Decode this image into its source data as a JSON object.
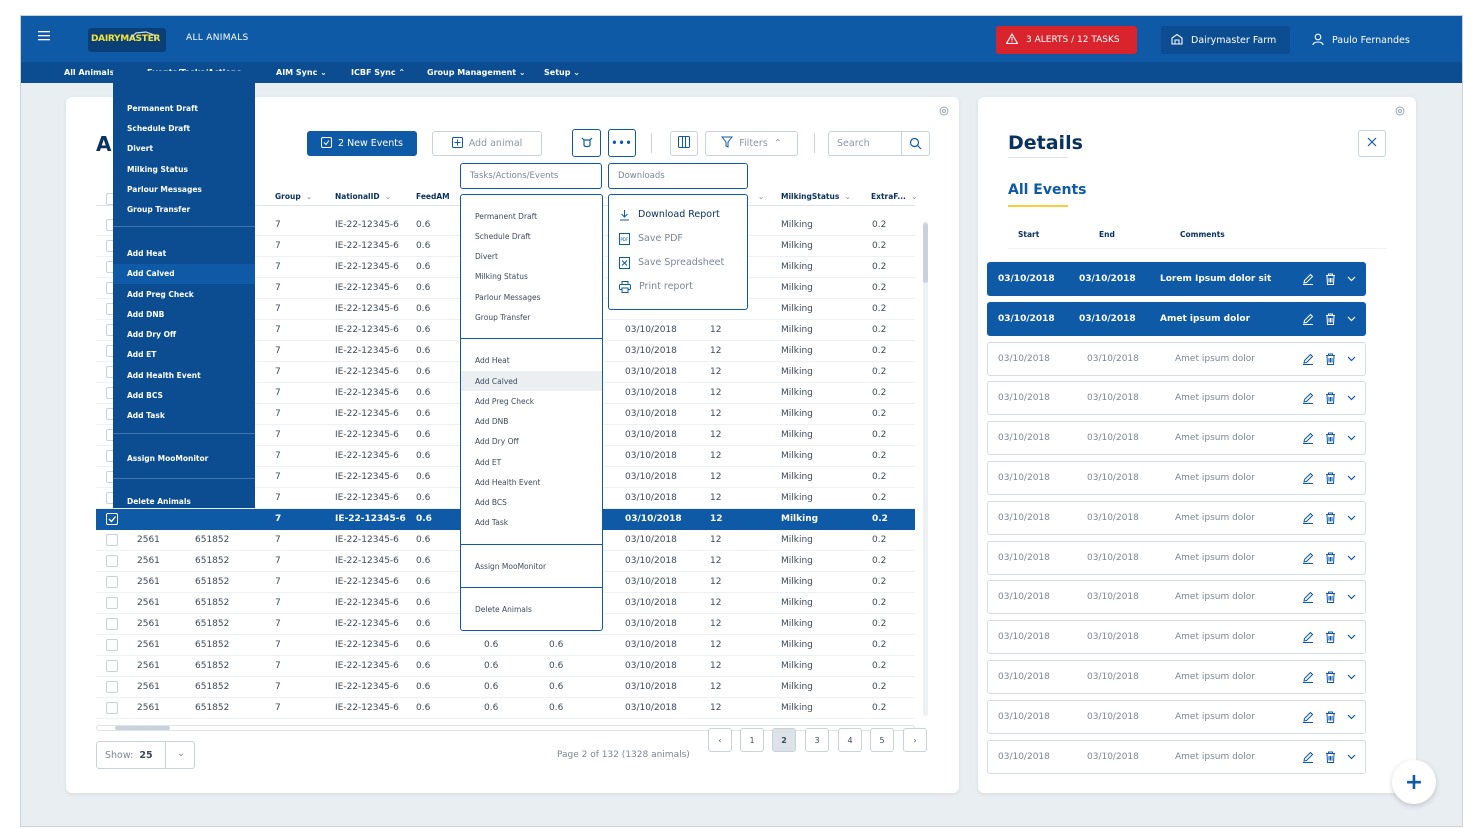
{
  "header": {
    "logo": "DAIRYMASTER",
    "section": "ALL ANIMALS",
    "alerts": "3 ALERTS / 12 TASKS",
    "farm": "Dairymaster Farm",
    "user": "Paulo Fernandes"
  },
  "nav": [
    "All Animals",
    "Events/Tasks/Actions",
    "AIM Sync",
    "ICBF Sync",
    "Group Management",
    "Setup"
  ],
  "main": {
    "title": "All",
    "new_events": "2 New Events",
    "add_animal": "Add animal",
    "filters": "Filters",
    "search_placeholder": "Search"
  },
  "columns": [
    "Group",
    "NationalID",
    "FeedAM",
    "MilkingStatus",
    "ExtraF..."
  ],
  "rows": [
    [
      "2561",
      "651852",
      "7",
      "IE-22-12345-6",
      "0.6",
      "0.6",
      "0.6",
      "03/10/2018",
      "12",
      "Milking",
      "0.2"
    ]
  ],
  "row_values": {
    "tag": "2561",
    "id": "651852",
    "group": "7",
    "national": "IE-22-12345-6",
    "feed": "0.6",
    "f2": "0.6",
    "f3": "0.6",
    "date": "03/10/2018",
    "num": "12",
    "status": "Milking",
    "extra": "0.2"
  },
  "partial_dates": [
    "03/10/2018"
  ],
  "dark_menu": {
    "group1": [
      "Permanent Draft",
      "Schedule Draft",
      "Divert",
      "Milking Status",
      "Parlour Messages",
      "Group Transfer"
    ],
    "group2": [
      "Add Heat",
      "Add Calved",
      "Add Preg Check",
      "Add DNB",
      "Add Dry Off",
      "Add ET",
      "Add Health Event",
      "Add BCS",
      "Add Task"
    ],
    "assign": "Assign MooMonitor",
    "delete": "Delete Animals"
  },
  "tasks_menu": {
    "label": "Tasks/Actions/Events",
    "group1": [
      "Permanent Draft",
      "Schedule Draft",
      "Divert",
      "Milking Status",
      "Parlour Messages",
      "Group Transfer"
    ],
    "group2": [
      "Add Heat",
      "Add Calved",
      "Add Preg Check",
      "Add DNB",
      "Add Dry Off",
      "Add ET",
      "Add Health Event",
      "Add BCS",
      "Add Task"
    ],
    "assign": "Assign MooMonitor",
    "delete": "Delete Animals"
  },
  "downloads_menu": {
    "label": "Downloads",
    "items": [
      "Download Report",
      "Save PDF",
      "Save Spreadsheet",
      "Print report"
    ]
  },
  "pagination": {
    "show_label": "Show:",
    "show_value": "25",
    "info": "Page 2 of 132 (1328 animals)",
    "pages": [
      "1",
      "2",
      "3",
      "4",
      "5"
    ]
  },
  "details": {
    "title": "Details",
    "section": "All Events",
    "col_start": "Start",
    "col_end": "End",
    "col_comments": "Comments",
    "events": [
      {
        "start": "03/10/2018",
        "end": "03/10/2018",
        "comment": "Lorem Ipsum dolor sit"
      },
      {
        "start": "03/10/2018",
        "end": "03/10/2018",
        "comment": "Amet ipsum dolor"
      },
      {
        "start": "03/10/2018",
        "end": "03/10/2018",
        "comment": "Amet ipsum dolor"
      },
      {
        "start": "03/10/2018",
        "end": "03/10/2018",
        "comment": "Amet ipsum dolor"
      },
      {
        "start": "03/10/2018",
        "end": "03/10/2018",
        "comment": "Amet ipsum dolor"
      },
      {
        "start": "03/10/2018",
        "end": "03/10/2018",
        "comment": "Amet ipsum dolor"
      },
      {
        "start": "03/10/2018",
        "end": "03/10/2018",
        "comment": "Amet ipsum dolor"
      },
      {
        "start": "03/10/2018",
        "end": "03/10/2018",
        "comment": "Amet ipsum dolor"
      },
      {
        "start": "03/10/2018",
        "end": "03/10/2018",
        "comment": "Amet ipsum dolor"
      },
      {
        "start": "03/10/2018",
        "end": "03/10/2018",
        "comment": "Amet ipsum dolor"
      },
      {
        "start": "03/10/2018",
        "end": "03/10/2018",
        "comment": "Amet ipsum dolor"
      },
      {
        "start": "03/10/2018",
        "end": "03/10/2018",
        "comment": "Amet ipsum dolor"
      },
      {
        "start": "03/10/2018",
        "end": "03/10/2018",
        "comment": "Amet ipsum dolor"
      }
    ]
  },
  "fab": "+",
  "colors": {
    "primary": "#0e5aa7",
    "navy": "#0b4d90",
    "alert": "#d9232d",
    "accent": "#f4e43a"
  }
}
